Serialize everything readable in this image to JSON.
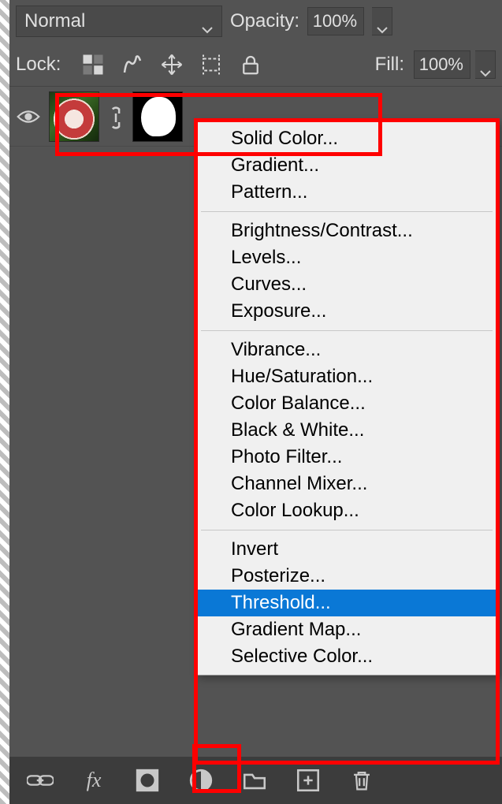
{
  "top": {
    "blend_mode": "Normal",
    "opacity_label": "Opacity:",
    "opacity_value": "100%"
  },
  "lock": {
    "label": "Lock:",
    "fill_label": "Fill:",
    "fill_value": "100%"
  },
  "menu": {
    "groups": [
      [
        "Solid Color...",
        "Gradient...",
        "Pattern..."
      ],
      [
        "Brightness/Contrast...",
        "Levels...",
        "Curves...",
        "Exposure..."
      ],
      [
        "Vibrance...",
        "Hue/Saturation...",
        "Color Balance...",
        "Black & White...",
        "Photo Filter...",
        "Channel Mixer...",
        "Color Lookup..."
      ],
      [
        "Invert",
        "Posterize...",
        "Threshold...",
        "Gradient Map...",
        "Selective Color..."
      ]
    ],
    "highlighted": "Threshold..."
  },
  "bottom": {
    "fx_label": "fx"
  }
}
